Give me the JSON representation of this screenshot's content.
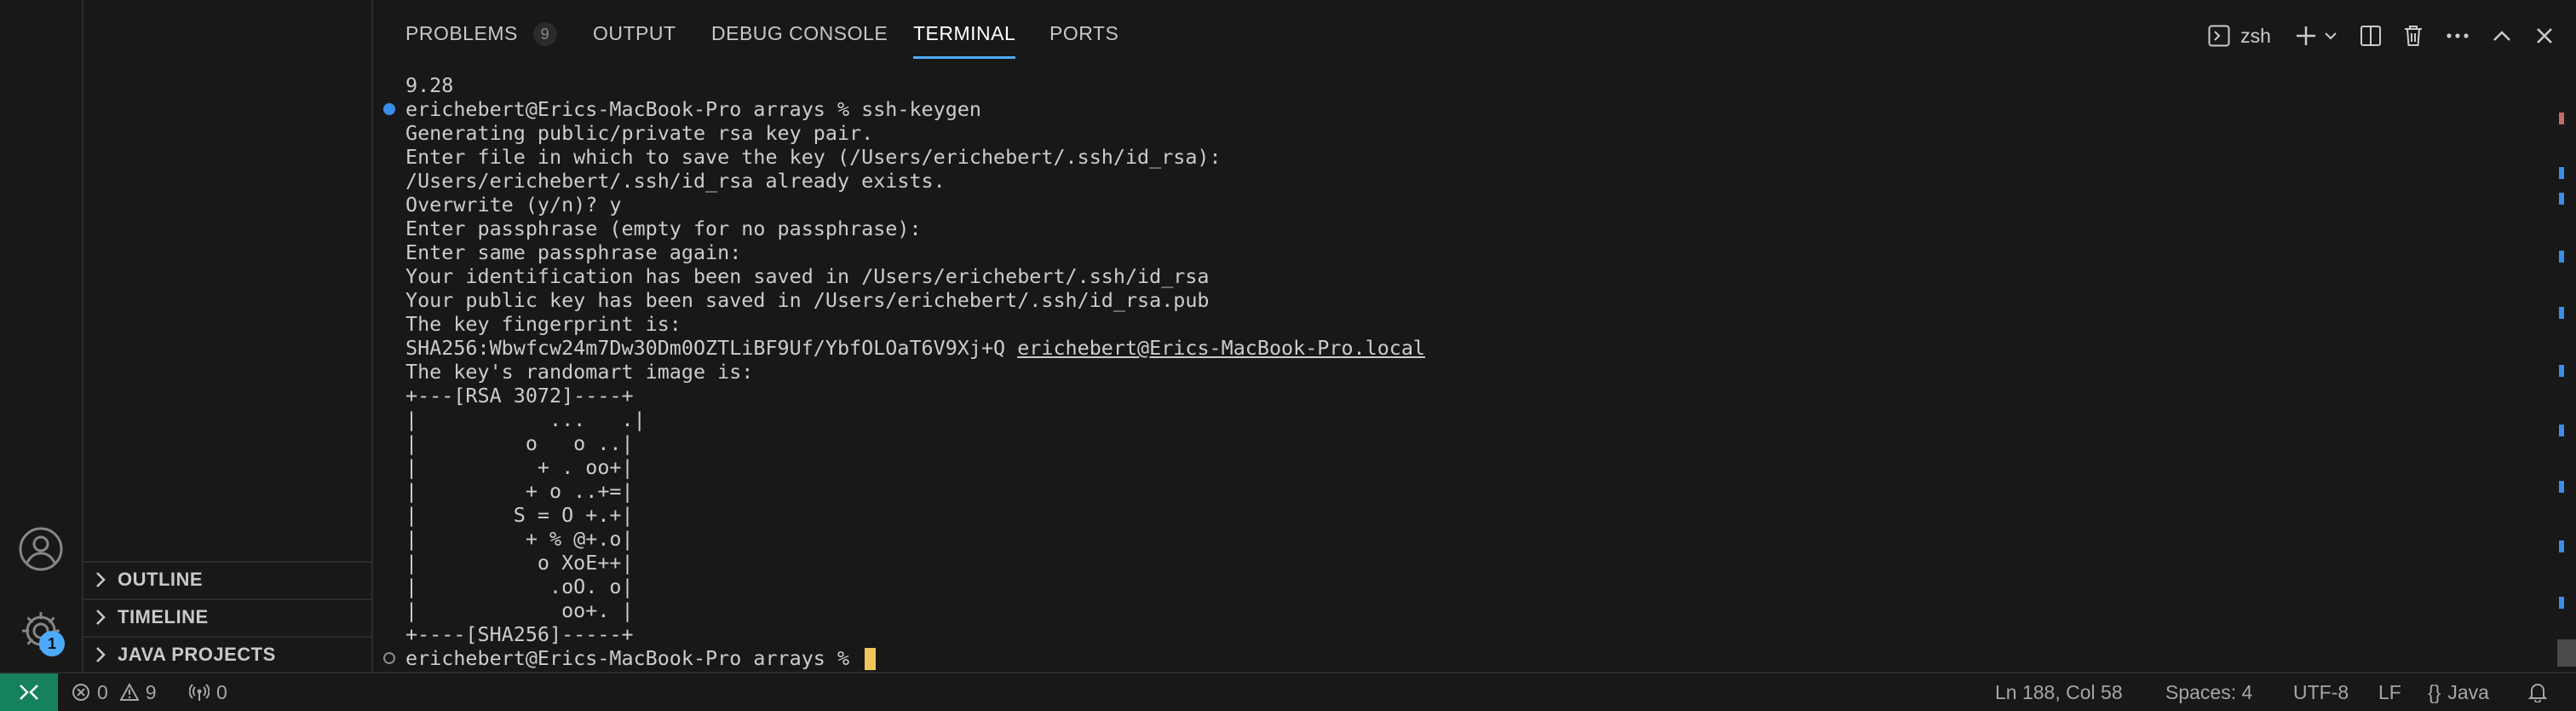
{
  "colors": {
    "accent": "#4daafc",
    "remote": "#16825d",
    "cursor": "#f2c55c"
  },
  "activity_bar": {
    "manage_badge": "1"
  },
  "sidebar": {
    "sections": [
      "OUTLINE",
      "TIMELINE",
      "JAVA PROJECTS"
    ]
  },
  "panel": {
    "tabs": [
      {
        "label": "PROBLEMS",
        "count": "9"
      },
      {
        "label": "OUTPUT"
      },
      {
        "label": "DEBUG CONSOLE"
      },
      {
        "label": "TERMINAL",
        "active": true
      },
      {
        "label": "PORTS"
      }
    ],
    "shell": "zsh"
  },
  "terminal": {
    "lines": [
      "9.28",
      "erichebert@Erics-MacBook-Pro arrays % ssh-keygen",
      "Generating public/private rsa key pair.",
      "Enter file in which to save the key (/Users/erichebert/.ssh/id_rsa):",
      "/Users/erichebert/.ssh/id_rsa already exists.",
      "Overwrite (y/n)? y",
      "Enter passphrase (empty for no passphrase):",
      "Enter same passphrase again:",
      "Your identification has been saved in /Users/erichebert/.ssh/id_rsa",
      "Your public key has been saved in /Users/erichebert/.ssh/id_rsa.pub",
      "The key fingerprint is:",
      "SHA256:Wbwfcw24m7Dw30Dm0OZTLiBF9Uf/YbfOLOaT6V9Xj+Q",
      "The key's randomart image is:",
      "+---[RSA 3072]----+",
      "|           ...   .|",
      "|         o   o ..|",
      "|          + . oo+|",
      "|         + o ..+=|",
      "|        S = O +.+|",
      "|         + % @+.o|",
      "|          o XoE++|",
      "|           .oO. o|",
      "|            oo+. |",
      "+----[SHA256]-----+"
    ],
    "fingerprint_link": "erichebert@Erics-MacBook-Pro.local",
    "prompt": "erichebert@Erics-MacBook-Pro arrays %"
  },
  "status": {
    "errors": "0",
    "warnings": "9",
    "ports": "0",
    "position": "Ln 188, Col 58",
    "spaces": "Spaces: 4",
    "encoding": "UTF-8",
    "eol": "LF",
    "language": "Java"
  }
}
